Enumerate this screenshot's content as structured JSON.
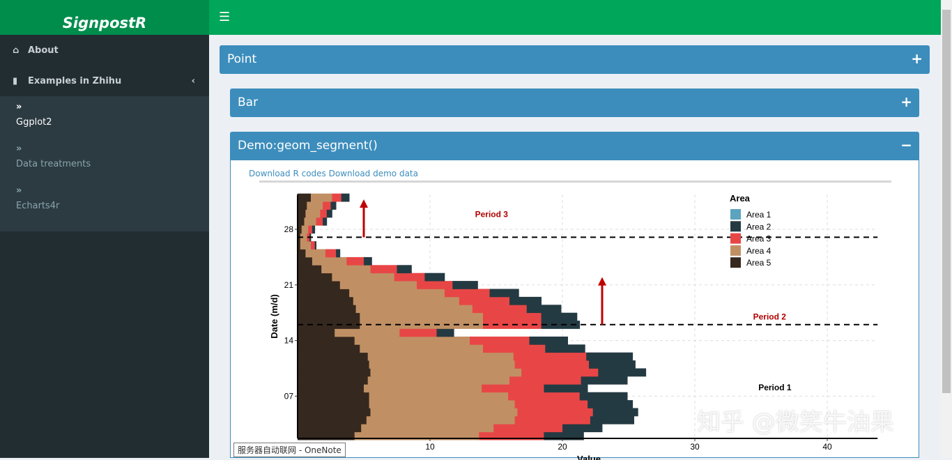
{
  "app": {
    "title": "SignpostR",
    "watermark": "知乎 @微笑牛油果",
    "tooltip": "服务器自动联网 - OneNote"
  },
  "sidebar": {
    "items": [
      {
        "label": "About",
        "icon": "home-icon"
      },
      {
        "label": "Examples in Zhihu",
        "icon": "book-icon"
      }
    ],
    "subitems": [
      {
        "label": "Ggplot2",
        "icon": "double-chevron-icon"
      },
      {
        "label": "Data treatments",
        "icon": "double-chevron-icon"
      },
      {
        "label": "Echarts4r",
        "icon": "double-chevron-icon"
      }
    ]
  },
  "boxes": [
    {
      "title": "Point",
      "toggle": "+"
    },
    {
      "title": "Bar",
      "toggle": "+"
    },
    {
      "title": "Demo:geom_segment()",
      "toggle": "−"
    }
  ],
  "links": {
    "codes": "Download R codes",
    "data": "Download demo data"
  },
  "colors": {
    "header": "#00a65a",
    "box": "#3c8dbc",
    "sidebar": "#222d32"
  },
  "chart_data": {
    "type": "bar",
    "orientation": "horizontal",
    "stacked": true,
    "ylabel": "Date (m/d)",
    "xlabel": "Value",
    "y": [
      2,
      3,
      4,
      5,
      6,
      7,
      8,
      9,
      10,
      11,
      12,
      13,
      14,
      15,
      16,
      17,
      18,
      19,
      20,
      21,
      22,
      23,
      24,
      25,
      26,
      27,
      28,
      29,
      30,
      31,
      32
    ],
    "yticks": [
      {
        "v": 7,
        "label": "07"
      },
      {
        "v": 14,
        "label": "14"
      },
      {
        "v": 21,
        "label": "21"
      },
      {
        "v": 28,
        "label": "28"
      }
    ],
    "xticks": [
      10,
      20,
      30,
      40
    ],
    "xlim": [
      0,
      43.8
    ],
    "grid": true,
    "legend": {
      "title": "Area",
      "placement": "top-right"
    },
    "series": [
      {
        "name": "Area 5",
        "color": "#35281e",
        "values": [
          4.3,
          4.8,
          5.2,
          5.5,
          5.4,
          5.4,
          5.0,
          5.3,
          5.5,
          5.4,
          5.3,
          4.7,
          4.3,
          2.8,
          4.7,
          4.7,
          4.4,
          4.2,
          3.9,
          3.2,
          2.6,
          1.8,
          1.1,
          0.6,
          0.2,
          0.2,
          0.3,
          0.5,
          0.6,
          0.7,
          1.0
        ]
      },
      {
        "name": "Area 4",
        "color": "#c09064",
        "values": [
          9.4,
          10.0,
          11.2,
          11.1,
          11.0,
          10.5,
          8.9,
          10.7,
          11.4,
          11.0,
          11.0,
          9.3,
          8.7,
          4.9,
          9.3,
          9.3,
          8.8,
          8.0,
          7.2,
          5.8,
          4.7,
          3.7,
          2.6,
          1.5,
          0.8,
          0.5,
          0.5,
          0.9,
          1.1,
          1.2,
          1.6
        ]
      },
      {
        "name": "Area 3",
        "color": "#e84646",
        "values": [
          4.9,
          5.2,
          5.7,
          5.7,
          5.5,
          5.4,
          4.7,
          5.4,
          5.8,
          5.6,
          5.5,
          4.7,
          4.5,
          2.8,
          4.4,
          4.4,
          4.1,
          3.8,
          3.4,
          2.7,
          2.3,
          2.0,
          1.3,
          0.8,
          0.3,
          0.2,
          0.3,
          0.5,
          0.5,
          0.6,
          0.7
        ]
      },
      {
        "name": "Area 2",
        "color": "#243a42",
        "values": [
          3.0,
          3.0,
          3.3,
          3.4,
          3.4,
          3.6,
          3.3,
          3.5,
          3.6,
          3.5,
          3.5,
          3.0,
          2.9,
          1.3,
          2.9,
          2.7,
          2.6,
          2.4,
          2.2,
          1.9,
          1.5,
          1.1,
          0.6,
          0.3,
          0.1,
          0.1,
          0.2,
          0.3,
          0.4,
          0.4,
          0.6
        ]
      },
      {
        "name": "Area 1",
        "color": "#5ba3be",
        "values": [
          0,
          0,
          0,
          0,
          0,
          0,
          0,
          0,
          0,
          0,
          0,
          0,
          0,
          0,
          0,
          0,
          0,
          0,
          0,
          0,
          0,
          0,
          0,
          0,
          0,
          0,
          0,
          0,
          0,
          0,
          0
        ]
      }
    ],
    "legend_order": [
      "Area 1",
      "Area 2",
      "Area 3",
      "Area 4",
      "Area 5"
    ],
    "hlines": [
      27,
      16
    ],
    "arrows": [
      {
        "x": 5,
        "from": 27,
        "to": 31.6
      },
      {
        "x": 23,
        "from": 16,
        "to": 21.8
      }
    ],
    "annotations": [
      {
        "text": "Period 3",
        "x": 13.4,
        "y": 29.9,
        "color": "#b00000"
      },
      {
        "text": "Period 2",
        "x": 34.4,
        "y": 17,
        "color": "#b00000"
      },
      {
        "text": "Period 1",
        "x": 34.8,
        "y": 8.1,
        "color": "#000000"
      }
    ]
  }
}
